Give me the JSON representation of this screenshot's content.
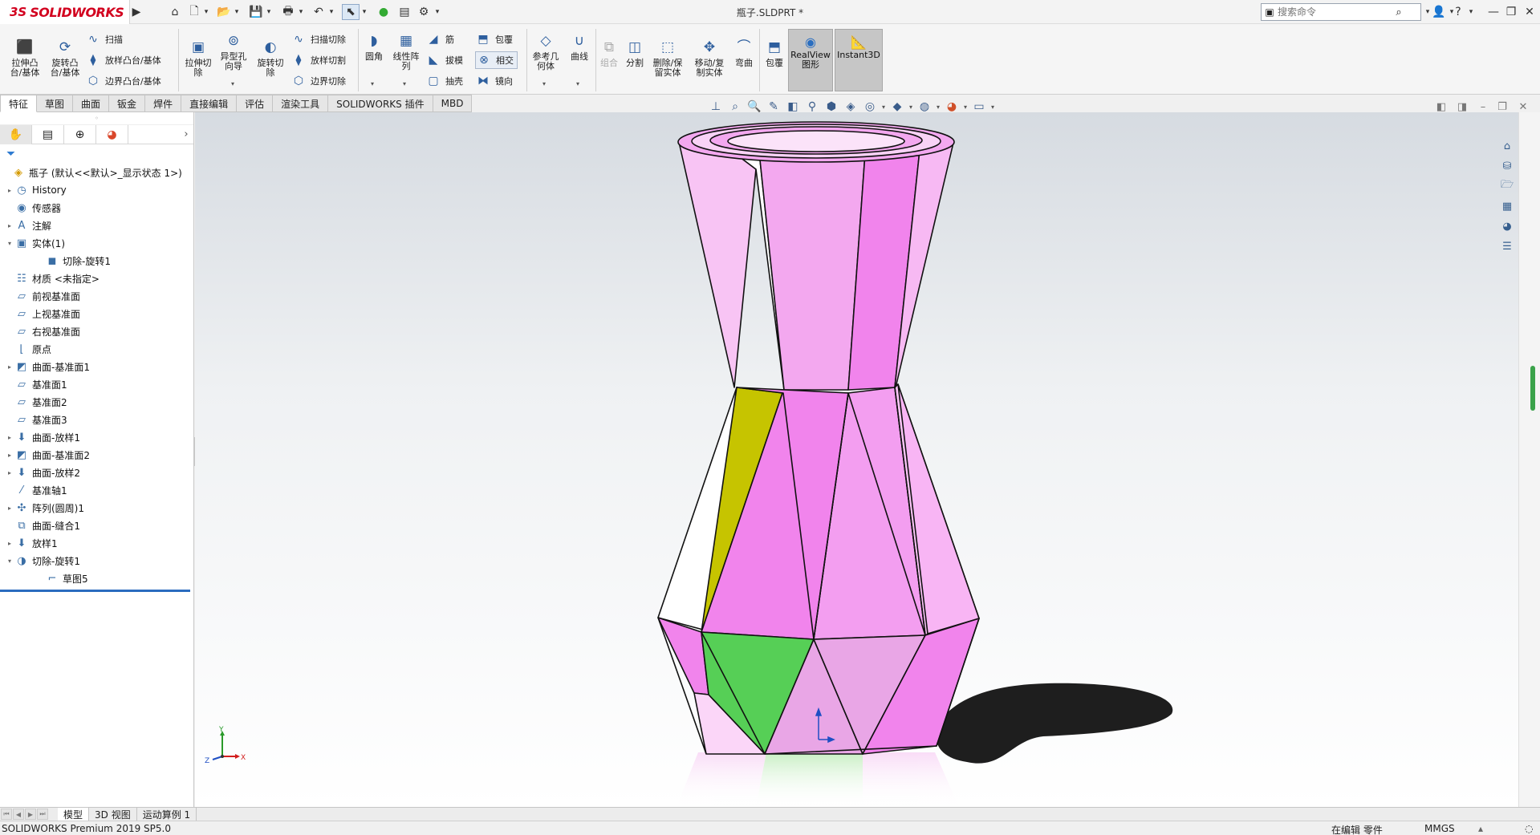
{
  "app": {
    "logo_prefix": "3S",
    "logo_name": "SOLIDWORKS",
    "document_title": "瓶子.SLDPRT *",
    "search_placeholder": "搜索命令"
  },
  "commands": {
    "extrude_boss": "拉伸凸\n台/基体",
    "revolve_boss": "旋转凸\n台/基体",
    "sweep": "扫描",
    "loft_boss": "放样凸台/基体",
    "boundary_boss": "边界凸台/基体",
    "extrude_cut": "拉伸切\n除",
    "hole_wizard": "异型孔\n向导",
    "revolve_cut": "旋转切\n除",
    "sweep_cut": "扫描切除",
    "loft_cut": "放样切割",
    "boundary_cut": "边界切除",
    "fillet": "圆角",
    "linear_pattern": "线性阵\n列",
    "rib": "筋",
    "draft": "拔模",
    "shell": "抽壳",
    "wrap": "包覆",
    "intersect": "相交",
    "mirror": "镜向",
    "ref_geometry": "参考几\n何体",
    "curves": "曲线",
    "combine": "组合",
    "split": "分割",
    "delete_keep_body": "删除/保\n留实体",
    "move_copy_body": "移动/复\n制实体",
    "flex": "弯曲",
    "wrap2": "包覆",
    "realview": "RealView\n图形",
    "instant3d": "Instant3D"
  },
  "tabs": [
    "特征",
    "草图",
    "曲面",
    "钣金",
    "焊件",
    "直接编辑",
    "评估",
    "渲染工具",
    "SOLIDWORKS 插件",
    "MBD"
  ],
  "feature_tree": [
    {
      "label": "瓶子  (默认<<默认>_显示状态 1>)",
      "icon": "part-icon",
      "expand": "",
      "indent": 0
    },
    {
      "label": "History",
      "icon": "history-icon",
      "expand": "▸",
      "indent": 1
    },
    {
      "label": "传感器",
      "icon": "sensor-icon",
      "expand": "",
      "indent": 1
    },
    {
      "label": "注解",
      "icon": "annotations-icon",
      "expand": "▸",
      "indent": 1
    },
    {
      "label": "实体(1)",
      "icon": "solid-bodies-icon",
      "expand": "▾",
      "indent": 1
    },
    {
      "label": "切除-旋转1",
      "icon": "body-icon",
      "expand": "",
      "indent": 2
    },
    {
      "label": "材质 <未指定>",
      "icon": "material-icon",
      "expand": "",
      "indent": 1
    },
    {
      "label": "前视基准面",
      "icon": "plane-icon",
      "expand": "",
      "indent": 1
    },
    {
      "label": "上视基准面",
      "icon": "plane-icon",
      "expand": "",
      "indent": 1
    },
    {
      "label": "右视基准面",
      "icon": "plane-icon",
      "expand": "",
      "indent": 1
    },
    {
      "label": "原点",
      "icon": "origin-icon",
      "expand": "",
      "indent": 1
    },
    {
      "label": "曲面-基准面1",
      "icon": "surface-plane-icon",
      "expand": "▸",
      "indent": 1
    },
    {
      "label": "基准面1",
      "icon": "plane-icon",
      "expand": "",
      "indent": 1
    },
    {
      "label": "基准面2",
      "icon": "plane-icon",
      "expand": "",
      "indent": 1
    },
    {
      "label": "基准面3",
      "icon": "plane-icon",
      "expand": "",
      "indent": 1
    },
    {
      "label": "曲面-放样1",
      "icon": "surface-loft-icon",
      "expand": "▸",
      "indent": 1
    },
    {
      "label": "曲面-基准面2",
      "icon": "surface-plane-icon",
      "expand": "▸",
      "indent": 1
    },
    {
      "label": "曲面-放样2",
      "icon": "surface-loft-icon",
      "expand": "▸",
      "indent": 1
    },
    {
      "label": "基准轴1",
      "icon": "axis-icon",
      "expand": "",
      "indent": 1
    },
    {
      "label": "阵列(圆周)1",
      "icon": "circular-pattern-icon",
      "expand": "▸",
      "indent": 1
    },
    {
      "label": "曲面-缝合1",
      "icon": "knit-icon",
      "expand": "",
      "indent": 1
    },
    {
      "label": "放样1",
      "icon": "loft-icon",
      "expand": "▸",
      "indent": 1
    },
    {
      "label": "切除-旋转1",
      "icon": "revolve-cut-icon",
      "expand": "▾",
      "indent": 1
    },
    {
      "label": "草图5",
      "icon": "sketch-icon",
      "expand": "",
      "indent": 2
    }
  ],
  "bottom_tabs": [
    "模型",
    "3D 视图",
    "运动算例 1"
  ],
  "status": {
    "product": "SOLIDWORKS Premium 2019 SP5.0",
    "editing": "在编辑 零件",
    "units": "MMGS"
  },
  "triad": {
    "y": "Y",
    "z": "Z",
    "x": "X"
  },
  "colors": {
    "body_pink": "#f3a6f0",
    "face_yellow": "#c6c400",
    "face_green": "#56cf56",
    "selection_blue": "#2b6cbf",
    "brand_red": "#d2001e"
  }
}
